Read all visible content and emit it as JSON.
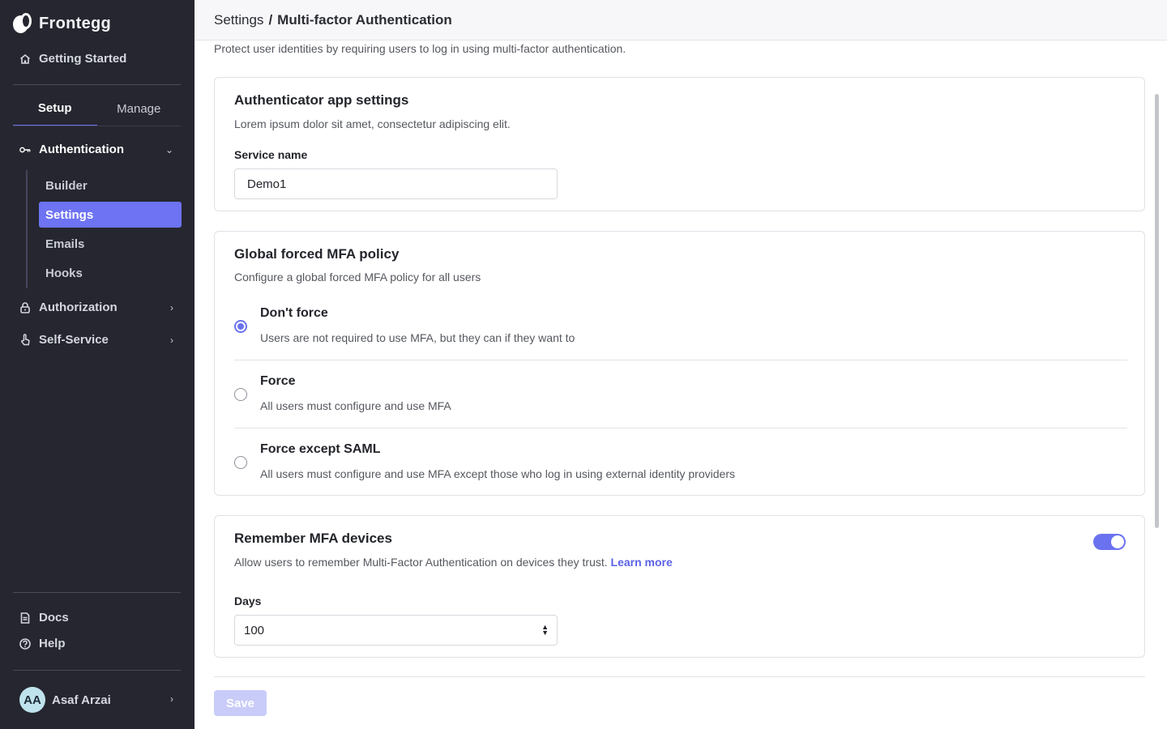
{
  "brand": {
    "name": "Frontegg"
  },
  "sidebar": {
    "getting_started": "Getting Started",
    "tabs": [
      {
        "label": "Setup"
      },
      {
        "label": "Manage"
      }
    ],
    "sections": {
      "authentication": "Authentication",
      "authorization": "Authorization",
      "self_service": "Self-Service"
    },
    "auth_items": [
      {
        "label": "Builder"
      },
      {
        "label": "Settings"
      },
      {
        "label": "Emails"
      },
      {
        "label": "Hooks"
      }
    ],
    "docs": "Docs",
    "help": "Help",
    "user": {
      "initials": "AA",
      "name": "Asaf Arzai"
    }
  },
  "header": {
    "crumb_parent": "Settings",
    "separator": "/",
    "crumb_current": "Multi-factor Authentication"
  },
  "page": {
    "description": "Protect user identities by requiring users to log in using multi-factor authentication."
  },
  "authenticator": {
    "title": "Authenticator app settings",
    "subtitle": "Lorem ipsum dolor sit amet, consectetur adipiscing elit.",
    "service_label": "Service name",
    "service_value": "Demo1"
  },
  "policy": {
    "title": "Global forced MFA policy",
    "subtitle": "Configure a global forced MFA policy for  all users",
    "options": [
      {
        "title": "Don't force",
        "desc": "Users are not required to use MFA, but they can if they want to",
        "checked": true
      },
      {
        "title": "Force",
        "desc": "All users must configure and use MFA",
        "checked": false
      },
      {
        "title": "Force except SAML",
        "desc": "All users must configure and use MFA except those who log in using external identity providers",
        "checked": false
      }
    ]
  },
  "remember": {
    "title": "Remember MFA devices",
    "subtitle": "Allow users to remember Multi-Factor Authentication on devices they trust.",
    "link": "Learn more",
    "enabled": true,
    "days_label": "Days",
    "days_value": "100"
  },
  "actions": {
    "save": "Save"
  },
  "colors": {
    "accent": "#6b72f0",
    "sidebar_bg": "#25262f"
  },
  "icons": [
    "home-icon",
    "key-icon",
    "chevron-down-icon",
    "lock-icon",
    "hand-icon",
    "chevron-right-icon",
    "document-icon",
    "help-circle-icon"
  ]
}
